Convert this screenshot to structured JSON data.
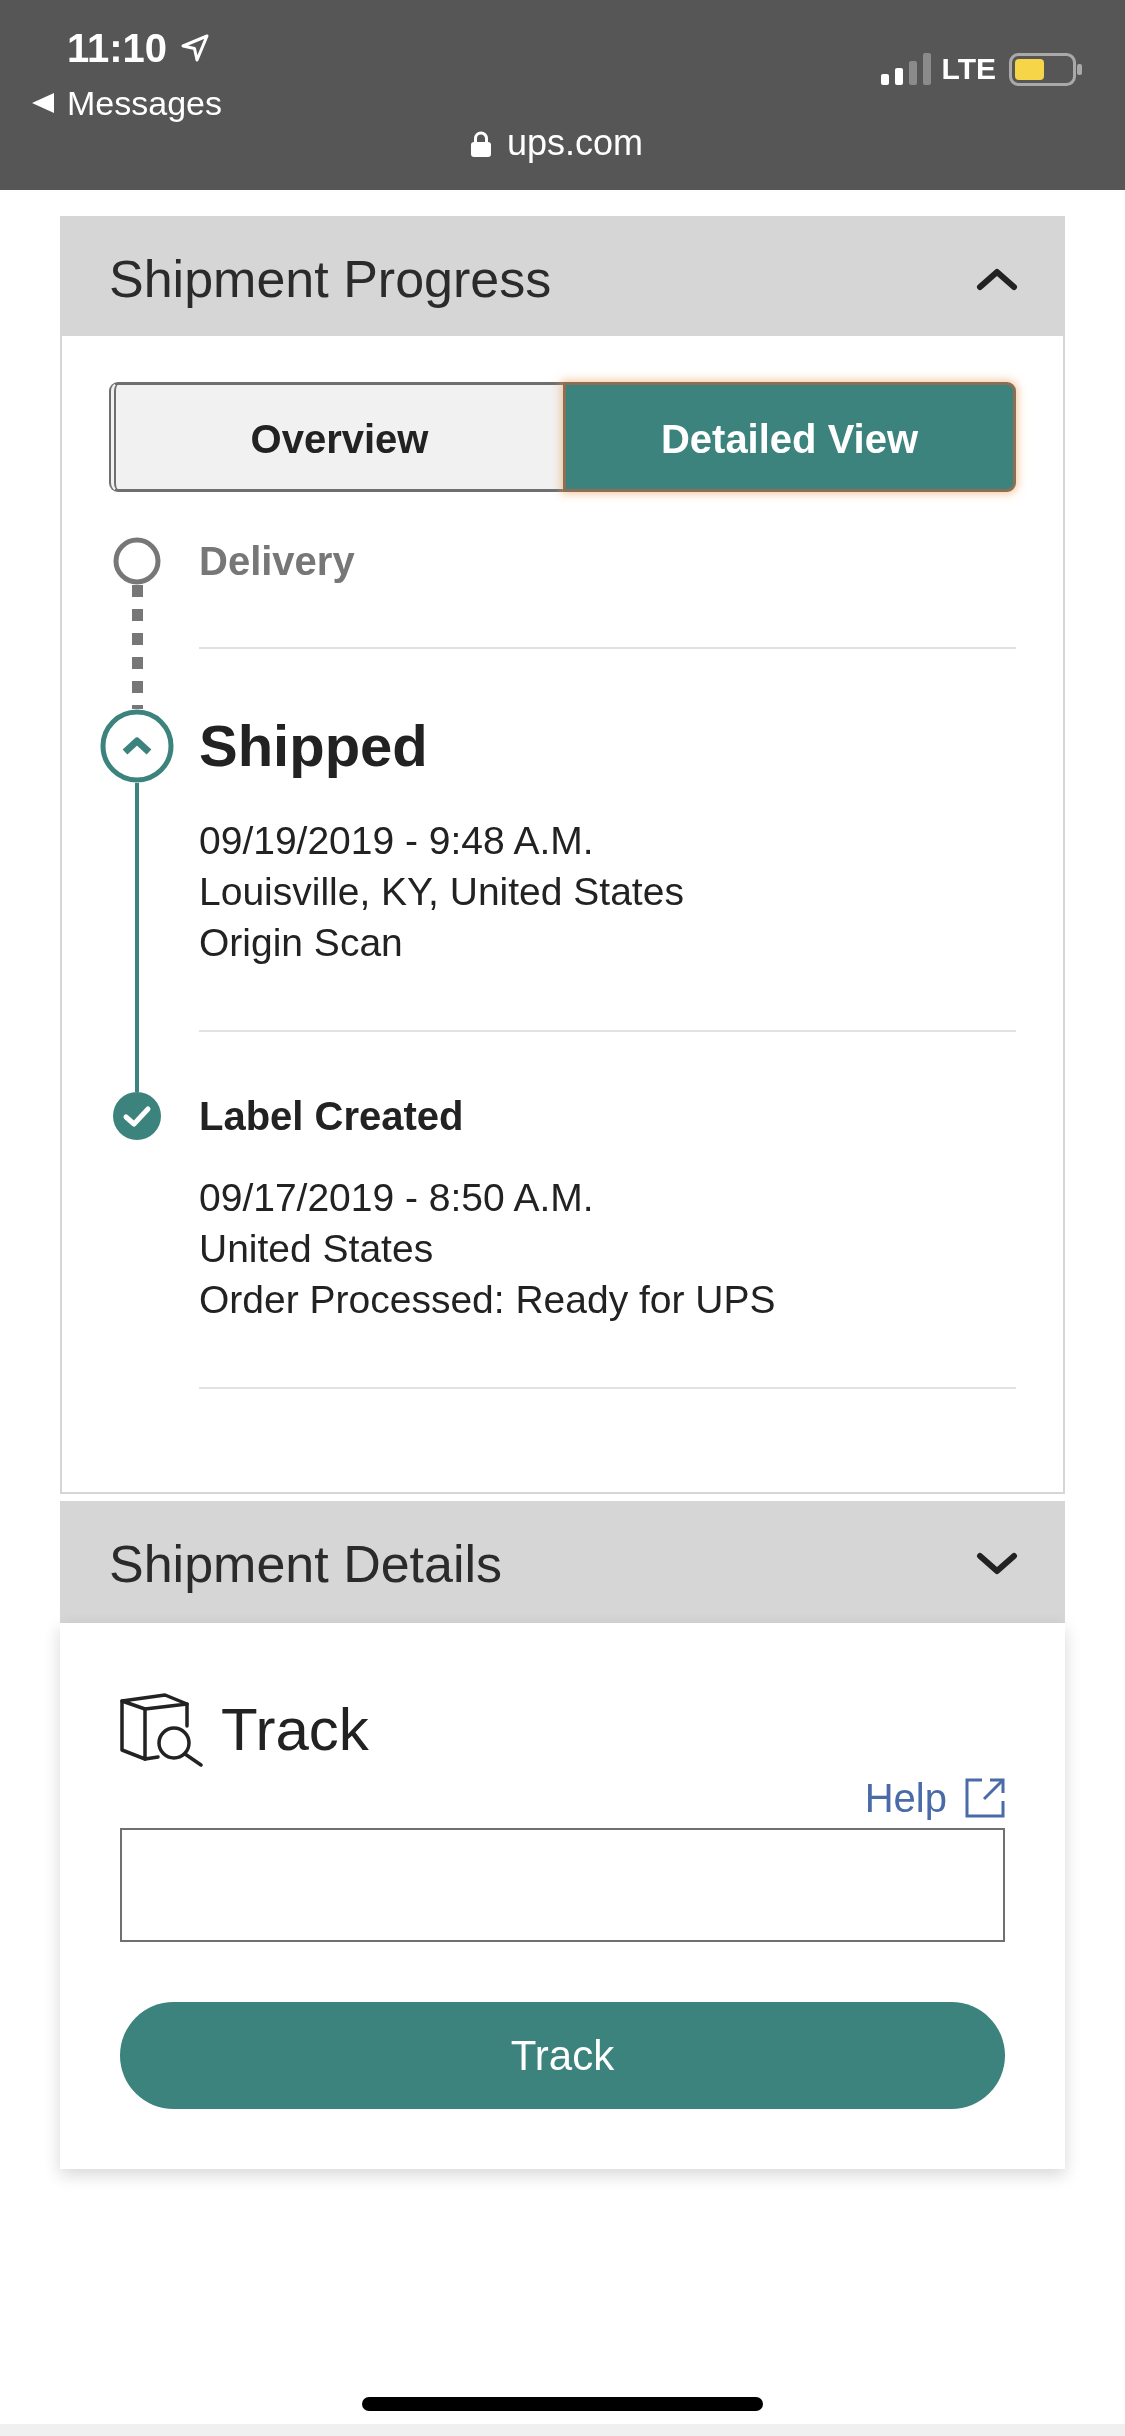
{
  "status_bar": {
    "time": "11:10",
    "back_label": "Messages",
    "url": "ups.com",
    "network": "LTE"
  },
  "sections": [
    {
      "title": "Shipment Progress",
      "expanded": true,
      "view_tabs": [
        {
          "label": "Overview",
          "selected": false
        },
        {
          "label": "Detailed View",
          "selected": true
        }
      ],
      "events": [
        {
          "title": "Delivery",
          "kind": "pending"
        },
        {
          "title": "Shipped",
          "kind": "current",
          "datetime": "09/19/2019 - 9:48 A.M.",
          "location": "Louisville, KY, United States",
          "activity": "Origin Scan"
        },
        {
          "title": "Label Created",
          "kind": "done",
          "datetime": "09/17/2019 - 8:50 A.M.",
          "location": "United States",
          "activity": "Order Processed: Ready for UPS"
        }
      ]
    },
    {
      "title": "Shipment Details",
      "expanded": false
    }
  ],
  "track": {
    "heading": "Track",
    "help_link": "Help",
    "button": "Track"
  }
}
